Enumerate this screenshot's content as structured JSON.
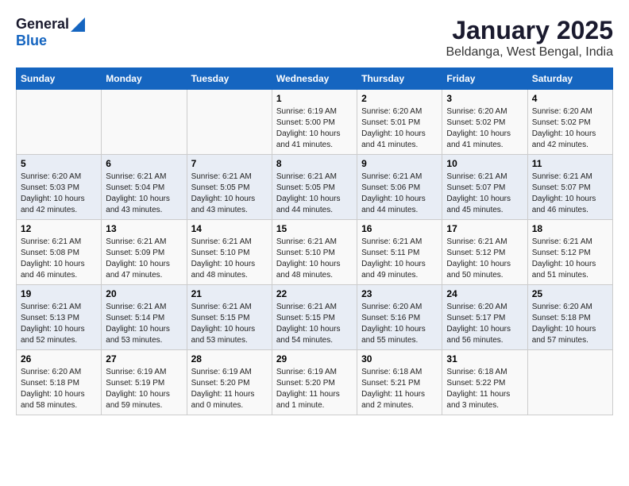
{
  "logo": {
    "general": "General",
    "blue": "Blue"
  },
  "title": "January 2025",
  "subtitle": "Beldanga, West Bengal, India",
  "weekdays": [
    "Sunday",
    "Monday",
    "Tuesday",
    "Wednesday",
    "Thursday",
    "Friday",
    "Saturday"
  ],
  "weeks": [
    [
      {
        "day": "",
        "info": ""
      },
      {
        "day": "",
        "info": ""
      },
      {
        "day": "",
        "info": ""
      },
      {
        "day": "1",
        "info": "Sunrise: 6:19 AM\nSunset: 5:00 PM\nDaylight: 10 hours\nand 41 minutes."
      },
      {
        "day": "2",
        "info": "Sunrise: 6:20 AM\nSunset: 5:01 PM\nDaylight: 10 hours\nand 41 minutes."
      },
      {
        "day": "3",
        "info": "Sunrise: 6:20 AM\nSunset: 5:02 PM\nDaylight: 10 hours\nand 41 minutes."
      },
      {
        "day": "4",
        "info": "Sunrise: 6:20 AM\nSunset: 5:02 PM\nDaylight: 10 hours\nand 42 minutes."
      }
    ],
    [
      {
        "day": "5",
        "info": "Sunrise: 6:20 AM\nSunset: 5:03 PM\nDaylight: 10 hours\nand 42 minutes."
      },
      {
        "day": "6",
        "info": "Sunrise: 6:21 AM\nSunset: 5:04 PM\nDaylight: 10 hours\nand 43 minutes."
      },
      {
        "day": "7",
        "info": "Sunrise: 6:21 AM\nSunset: 5:05 PM\nDaylight: 10 hours\nand 43 minutes."
      },
      {
        "day": "8",
        "info": "Sunrise: 6:21 AM\nSunset: 5:05 PM\nDaylight: 10 hours\nand 44 minutes."
      },
      {
        "day": "9",
        "info": "Sunrise: 6:21 AM\nSunset: 5:06 PM\nDaylight: 10 hours\nand 44 minutes."
      },
      {
        "day": "10",
        "info": "Sunrise: 6:21 AM\nSunset: 5:07 PM\nDaylight: 10 hours\nand 45 minutes."
      },
      {
        "day": "11",
        "info": "Sunrise: 6:21 AM\nSunset: 5:07 PM\nDaylight: 10 hours\nand 46 minutes."
      }
    ],
    [
      {
        "day": "12",
        "info": "Sunrise: 6:21 AM\nSunset: 5:08 PM\nDaylight: 10 hours\nand 46 minutes."
      },
      {
        "day": "13",
        "info": "Sunrise: 6:21 AM\nSunset: 5:09 PM\nDaylight: 10 hours\nand 47 minutes."
      },
      {
        "day": "14",
        "info": "Sunrise: 6:21 AM\nSunset: 5:10 PM\nDaylight: 10 hours\nand 48 minutes."
      },
      {
        "day": "15",
        "info": "Sunrise: 6:21 AM\nSunset: 5:10 PM\nDaylight: 10 hours\nand 48 minutes."
      },
      {
        "day": "16",
        "info": "Sunrise: 6:21 AM\nSunset: 5:11 PM\nDaylight: 10 hours\nand 49 minutes."
      },
      {
        "day": "17",
        "info": "Sunrise: 6:21 AM\nSunset: 5:12 PM\nDaylight: 10 hours\nand 50 minutes."
      },
      {
        "day": "18",
        "info": "Sunrise: 6:21 AM\nSunset: 5:12 PM\nDaylight: 10 hours\nand 51 minutes."
      }
    ],
    [
      {
        "day": "19",
        "info": "Sunrise: 6:21 AM\nSunset: 5:13 PM\nDaylight: 10 hours\nand 52 minutes."
      },
      {
        "day": "20",
        "info": "Sunrise: 6:21 AM\nSunset: 5:14 PM\nDaylight: 10 hours\nand 53 minutes."
      },
      {
        "day": "21",
        "info": "Sunrise: 6:21 AM\nSunset: 5:15 PM\nDaylight: 10 hours\nand 53 minutes."
      },
      {
        "day": "22",
        "info": "Sunrise: 6:21 AM\nSunset: 5:15 PM\nDaylight: 10 hours\nand 54 minutes."
      },
      {
        "day": "23",
        "info": "Sunrise: 6:20 AM\nSunset: 5:16 PM\nDaylight: 10 hours\nand 55 minutes."
      },
      {
        "day": "24",
        "info": "Sunrise: 6:20 AM\nSunset: 5:17 PM\nDaylight: 10 hours\nand 56 minutes."
      },
      {
        "day": "25",
        "info": "Sunrise: 6:20 AM\nSunset: 5:18 PM\nDaylight: 10 hours\nand 57 minutes."
      }
    ],
    [
      {
        "day": "26",
        "info": "Sunrise: 6:20 AM\nSunset: 5:18 PM\nDaylight: 10 hours\nand 58 minutes."
      },
      {
        "day": "27",
        "info": "Sunrise: 6:19 AM\nSunset: 5:19 PM\nDaylight: 10 hours\nand 59 minutes."
      },
      {
        "day": "28",
        "info": "Sunrise: 6:19 AM\nSunset: 5:20 PM\nDaylight: 11 hours\nand 0 minutes."
      },
      {
        "day": "29",
        "info": "Sunrise: 6:19 AM\nSunset: 5:20 PM\nDaylight: 11 hours\nand 1 minute."
      },
      {
        "day": "30",
        "info": "Sunrise: 6:18 AM\nSunset: 5:21 PM\nDaylight: 11 hours\nand 2 minutes."
      },
      {
        "day": "31",
        "info": "Sunrise: 6:18 AM\nSunset: 5:22 PM\nDaylight: 11 hours\nand 3 minutes."
      },
      {
        "day": "",
        "info": ""
      }
    ]
  ]
}
